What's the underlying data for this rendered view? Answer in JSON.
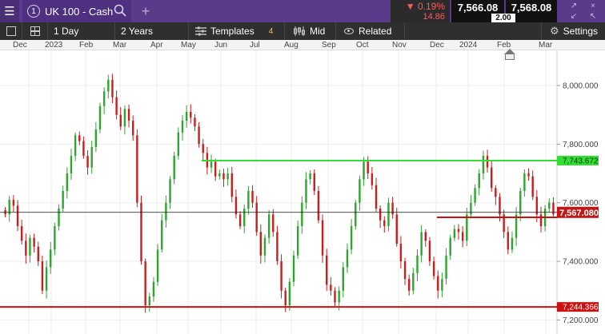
{
  "topbar": {
    "menu_icon": "hamburger-icon",
    "market_index": "1",
    "market_name": "UK 100 - Cash",
    "search_icon": "search-icon",
    "add_icon": "plus-icon",
    "change_pct": "▼ 0.19%",
    "change_abs": "14.86",
    "sell_price": "7,566.08",
    "buy_price": "7,568.08",
    "spread": "2.00",
    "window_icons": [
      "↗",
      "×",
      "↙",
      "↖"
    ]
  },
  "toolbar": {
    "period": "1 Day",
    "range": "2 Years",
    "templates_label": "Templates",
    "templates_count": "4",
    "price_type": "Mid",
    "related_label": "Related",
    "settings_label": "Settings"
  },
  "timeline": {
    "months": [
      "Dec",
      "2023",
      "Feb",
      "Mar",
      "Apr",
      "May",
      "Jun",
      "Jul",
      "Aug",
      "Sep",
      "Oct",
      "Nov",
      "Dec",
      "2024",
      "Feb",
      "Mar"
    ]
  },
  "chart_data": {
    "type": "candlestick",
    "colors": {
      "up": "#2fa52f",
      "down": "#c81e1e",
      "resistance": "#33dd33",
      "support": "#cc1111",
      "current": "#111111"
    },
    "y_ticks": [
      8000,
      7800,
      7600,
      7400,
      7200
    ],
    "y_tick_labels": [
      "8,000.000",
      "7,800.000",
      "7,600.000",
      "7,400.000",
      "7,200.000"
    ],
    "ylim": [
      7152,
      8120
    ],
    "current_price_label": "7,567.080",
    "current_price": 7567.08,
    "levels": [
      {
        "label": "7,743.672",
        "value": 7743.672,
        "color": "#33dd33"
      },
      {
        "label": "7,244.366",
        "value": 7244.366,
        "color": "#cc1111"
      },
      {
        "label": "",
        "value": 7550,
        "color": "#cc1111"
      }
    ],
    "closes": [
      7560,
      7610,
      7590,
      7520,
      7470,
      7420,
      7480,
      7450,
      7400,
      7300,
      7380,
      7440,
      7520,
      7580,
      7640,
      7700,
      7760,
      7830,
      7810,
      7760,
      7720,
      7790,
      7850,
      7930,
      7980,
      8020,
      7960,
      7900,
      7860,
      7920,
      7880,
      7830,
      7600,
      7400,
      7250,
      7280,
      7330,
      7440,
      7540,
      7600,
      7680,
      7760,
      7840,
      7880,
      7910,
      7890,
      7860,
      7800,
      7770,
      7720,
      7740,
      7690,
      7700,
      7680,
      7700,
      7620,
      7560,
      7520,
      7580,
      7640,
      7600,
      7500,
      7420,
      7480,
      7560,
      7500,
      7400,
      7300,
      7250,
      7330,
      7420,
      7520,
      7600,
      7680,
      7700,
      7640,
      7540,
      7420,
      7320,
      7300,
      7260,
      7300,
      7380,
      7440,
      7520,
      7600,
      7680,
      7740,
      7700,
      7660,
      7580,
      7540,
      7520,
      7600,
      7560,
      7460,
      7400,
      7340,
      7300,
      7360,
      7420,
      7500,
      7470,
      7400,
      7350,
      7300,
      7340,
      7420,
      7480,
      7510,
      7500,
      7470,
      7560,
      7600,
      7650,
      7700,
      7760,
      7720,
      7650,
      7620,
      7560,
      7500,
      7440,
      7480,
      7560,
      7640,
      7700,
      7690,
      7620,
      7560,
      7520,
      7580,
      7600,
      7560
    ]
  }
}
